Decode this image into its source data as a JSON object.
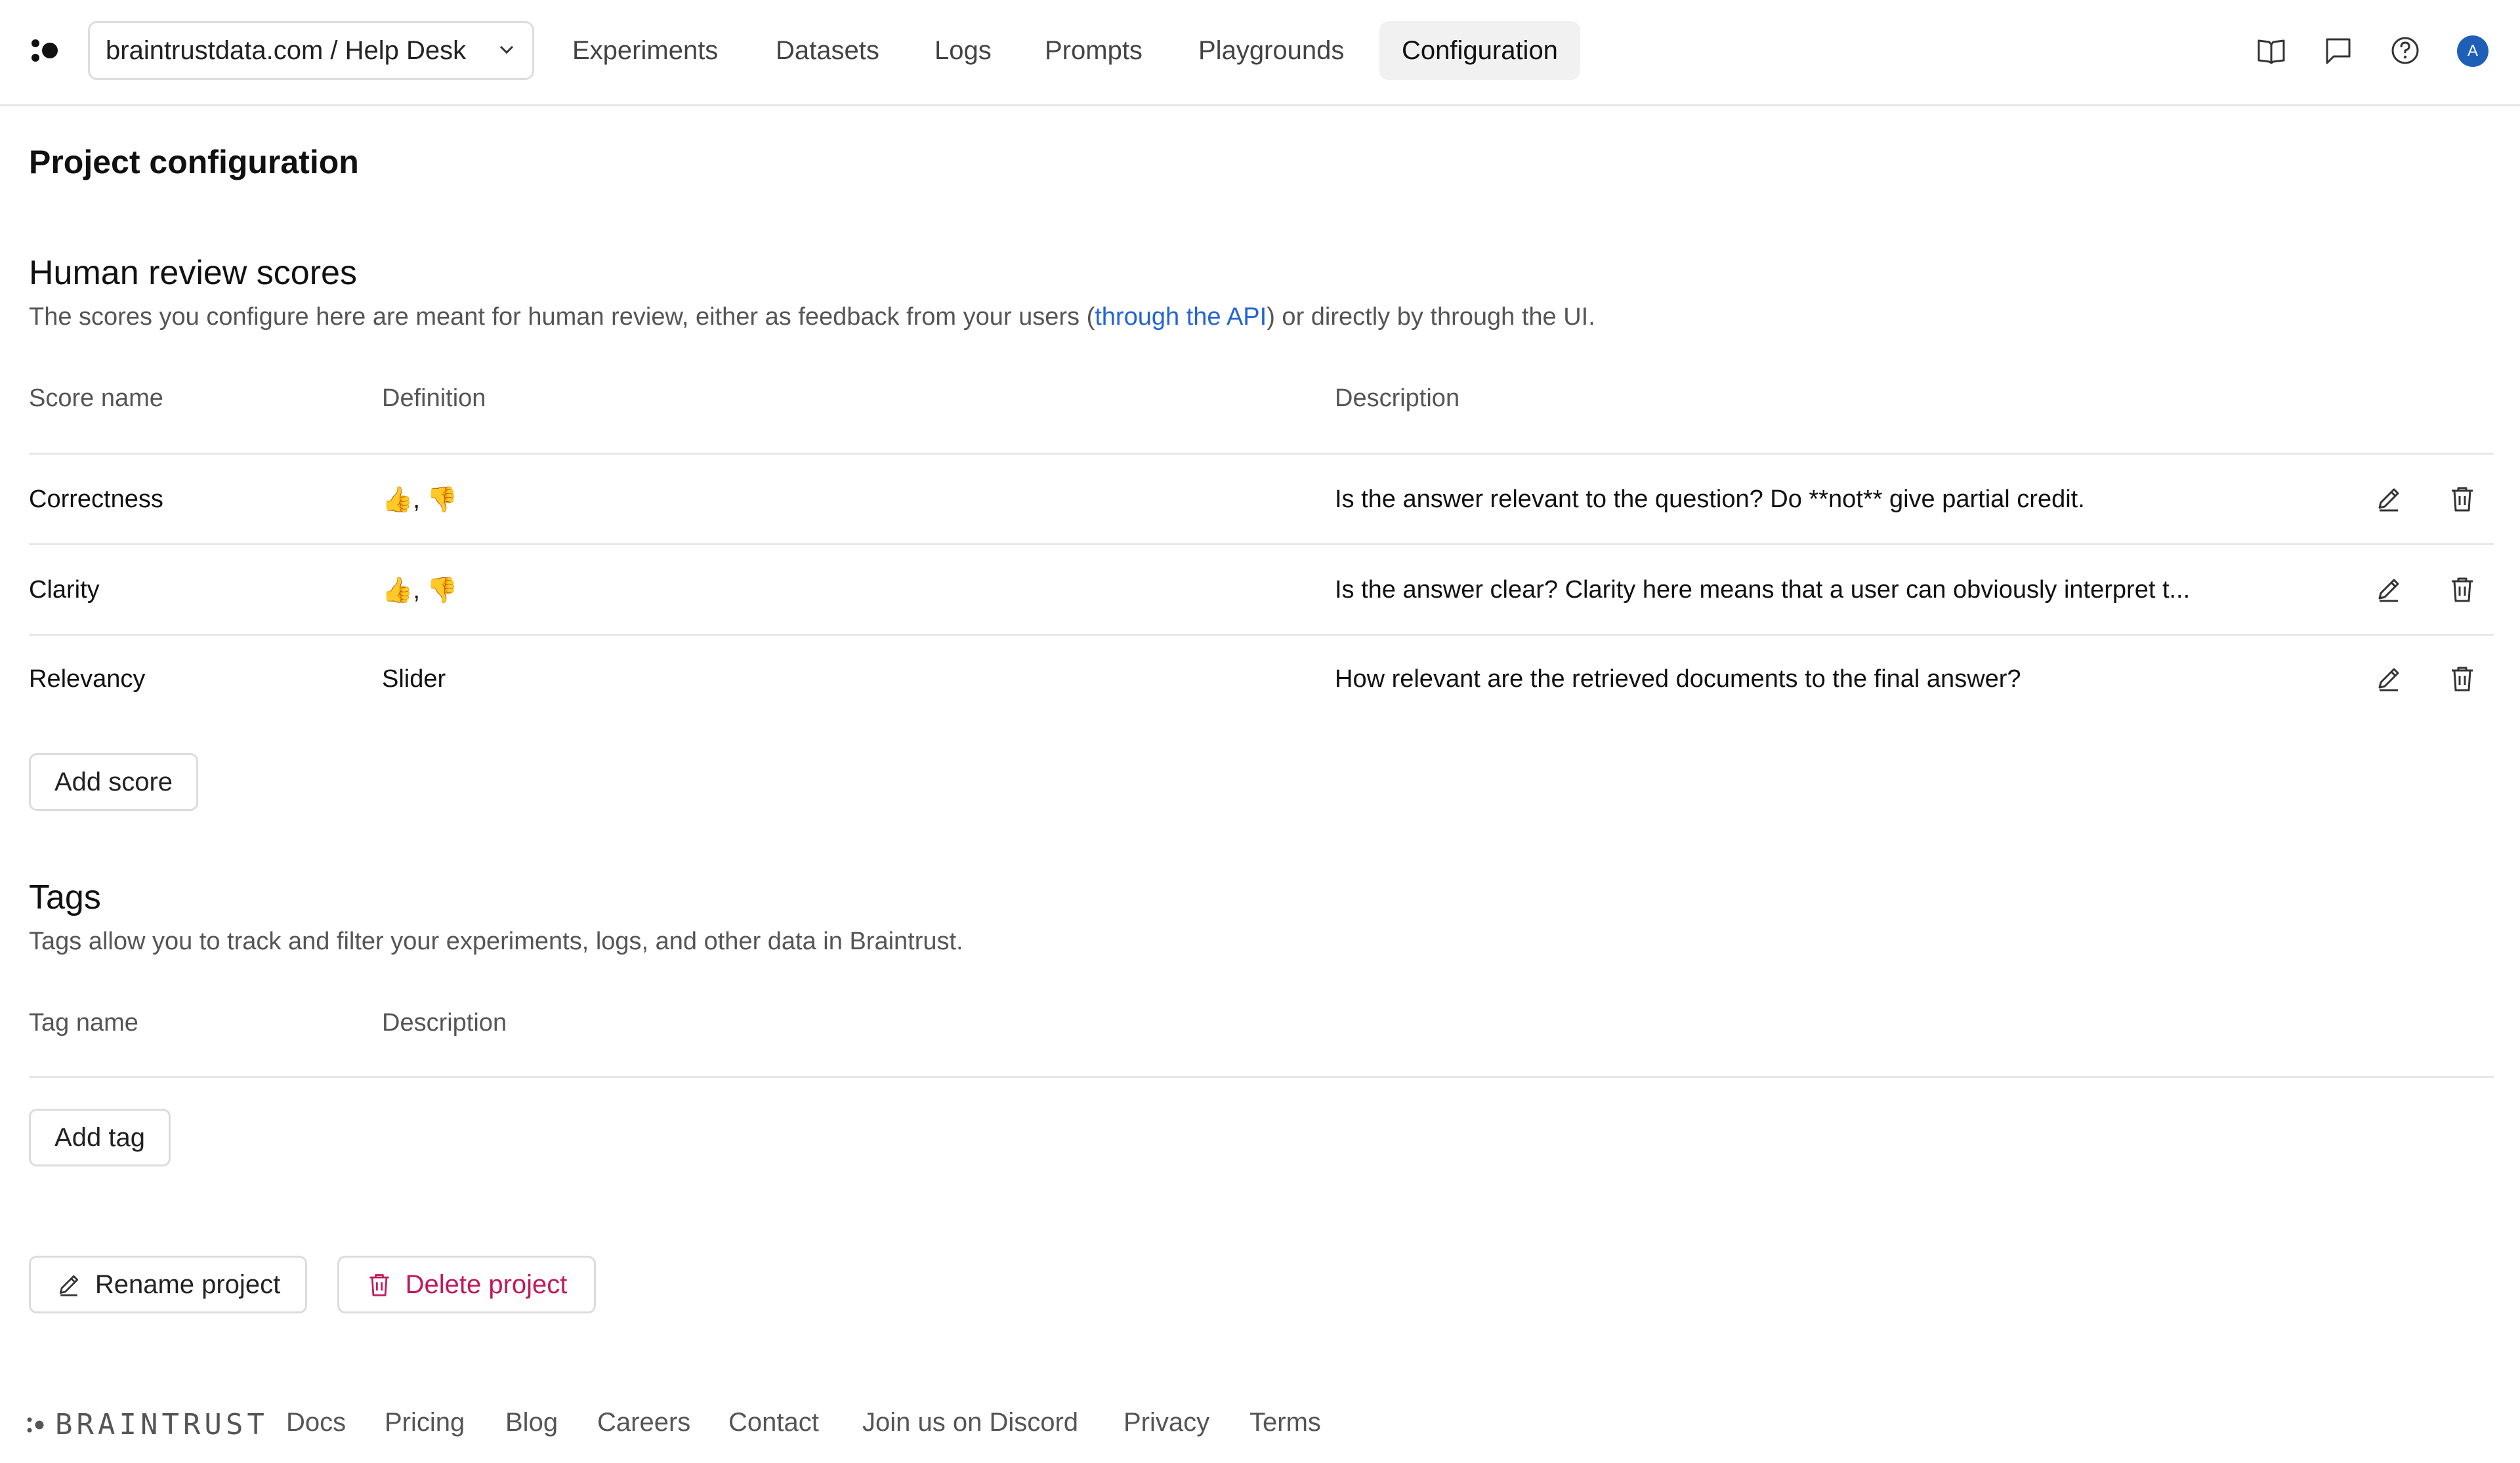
{
  "header": {
    "project": "braintrustdata.com / Help Desk",
    "tabs": [
      "Experiments",
      "Datasets",
      "Logs",
      "Prompts",
      "Playgrounds",
      "Configuration"
    ],
    "active_tab": "Configuration",
    "icons": [
      "book-icon",
      "chat-icon",
      "help-icon"
    ],
    "avatar_initial": "A"
  },
  "page_title": "Project configuration",
  "scores": {
    "title": "Human review scores",
    "desc_prefix": "The scores you configure here are meant for human review, either as feedback from your users (",
    "desc_link": "through the API",
    "desc_suffix": ") or directly by through the UI.",
    "columns": [
      "Score name",
      "Definition",
      "Description"
    ],
    "rows": [
      {
        "name": "Correctness",
        "definition": "👍, 👎",
        "description": "Is the answer relevant to the question? Do **not** give partial credit."
      },
      {
        "name": "Clarity",
        "definition": "👍, 👎",
        "description": "Is the answer clear? Clarity here means that a user can obviously interpret t..."
      },
      {
        "name": "Relevancy",
        "definition": "Slider",
        "description": "How relevant are the retrieved documents to the final answer?"
      }
    ],
    "add_label": "Add score"
  },
  "tags": {
    "title": "Tags",
    "desc": "Tags allow you to track and filter your experiments, logs, and other data in Braintrust.",
    "columns": [
      "Tag name",
      "Description"
    ],
    "add_label": "Add tag"
  },
  "actions": {
    "rename_label": "Rename project",
    "delete_label": "Delete project"
  },
  "footer": {
    "brand": "BRAINTRUST",
    "links": [
      "Docs",
      "Pricing",
      "Blog",
      "Careers",
      "Contact",
      "Join us on Discord",
      "Privacy",
      "Terms"
    ]
  },
  "colors": {
    "accent": "#2363d8",
    "danger": "#c2185b",
    "avatar": "#1f5fb8"
  }
}
